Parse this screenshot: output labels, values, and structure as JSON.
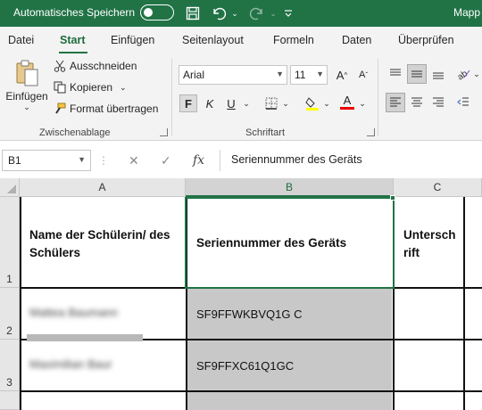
{
  "titlebar": {
    "autosave_label": "Automatisches Speichern",
    "app_title": "Mapp",
    "icons": [
      "save-icon",
      "undo-icon",
      "redo-icon",
      "customize-icon"
    ]
  },
  "tabs": [
    "Datei",
    "Start",
    "Einfügen",
    "Seitenlayout",
    "Formeln",
    "Daten",
    "Überprüfen"
  ],
  "active_tab": "Start",
  "clipboard": {
    "paste_label": "Einfügen",
    "cut_label": "Ausschneiden",
    "copy_label": "Kopieren",
    "format_painter_label": "Format übertragen",
    "group_label": "Zwischenablage"
  },
  "font": {
    "font_name": "Arial",
    "font_size": "11",
    "bold": "F",
    "italic": "K",
    "underline": "U",
    "font_color_letter": "A",
    "group_label": "Schriftart"
  },
  "formula_bar": {
    "name_box": "B1",
    "fx": "fx",
    "value": "Seriennummer des Geräts"
  },
  "columns": [
    "A",
    "B",
    "C"
  ],
  "rows": [
    "1",
    "2",
    "3"
  ],
  "cells": {
    "a1": "Name der Schülerin/ des Schülers",
    "b1": "Seriennummer des Geräts",
    "c1": "Untersch rift",
    "a2": "Mattea Baumann",
    "b2": "SF9FFWKBVQ1G C",
    "a3": "Maximilian Baur",
    "b3": "SF9FFXC61Q1GC"
  },
  "colors": {
    "accent": "#217346",
    "shaded_fill": "#c8c8c8"
  }
}
